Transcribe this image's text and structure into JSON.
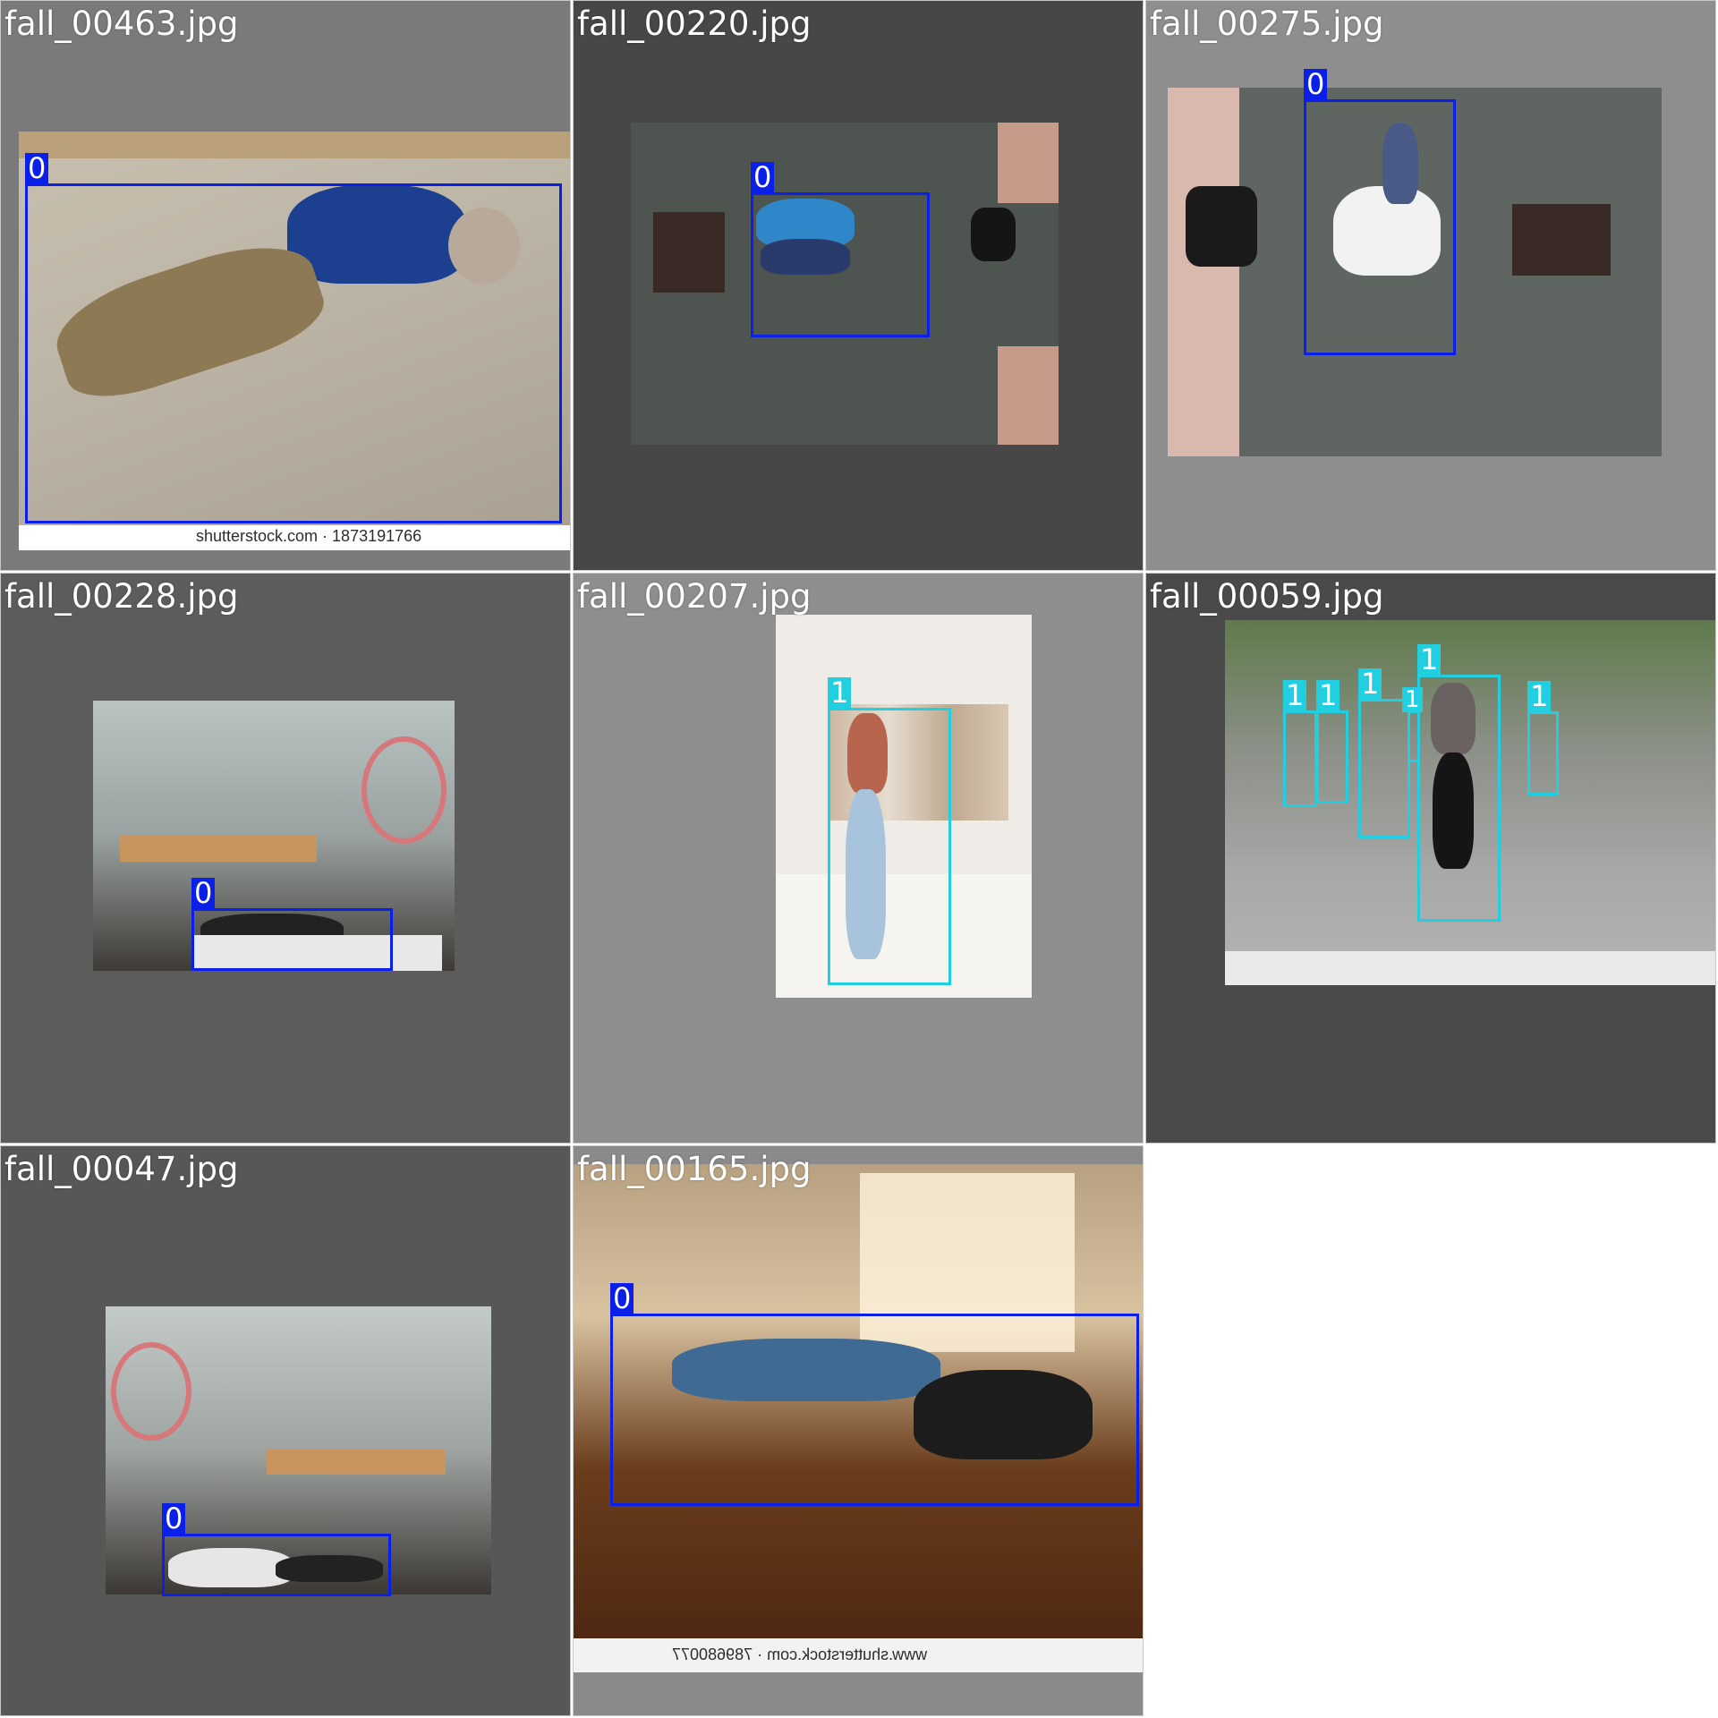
{
  "tiles": [
    {
      "filename": "fall_00463.jpg",
      "watermark": "shutterstock.com · 1873191766",
      "labels": [
        "0"
      ]
    },
    {
      "filename": "fall_00220.jpg",
      "labels": [
        "0"
      ]
    },
    {
      "filename": "fall_00275.jpg",
      "labels": [
        "0"
      ]
    },
    {
      "filename": "fall_00228.jpg",
      "labels": [
        "0"
      ]
    },
    {
      "filename": "fall_00207.jpg",
      "labels": [
        "1"
      ]
    },
    {
      "filename": "fall_00059.jpg",
      "labels": [
        "1",
        "1",
        "1",
        "1",
        "1",
        "1"
      ]
    },
    {
      "filename": "fall_00047.jpg",
      "labels": [
        "0"
      ]
    },
    {
      "filename": "fall_00165.jpg",
      "watermark": "www.shutterstock.com · 789680077",
      "labels": [
        "0"
      ]
    }
  ],
  "colors": {
    "class_0": "#0a1fe8",
    "class_1": "#22cfe0"
  }
}
